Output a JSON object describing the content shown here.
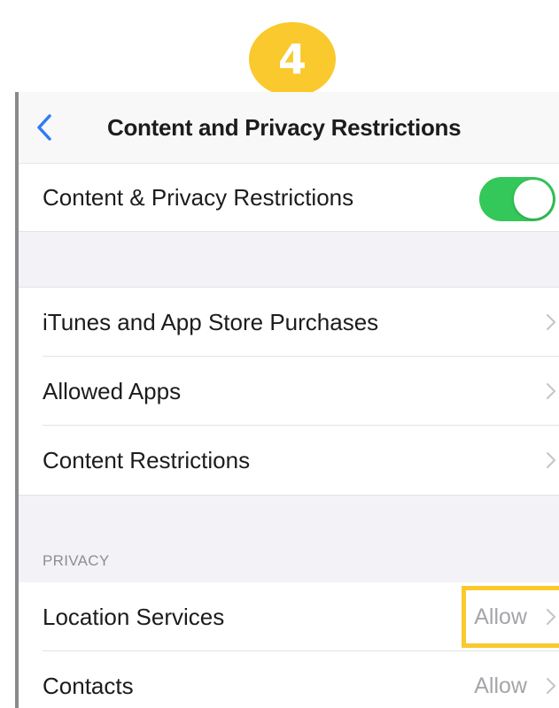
{
  "step_badge": "4",
  "navbar": {
    "title": "Content and Privacy Restrictions",
    "back_icon": "chevron-left-icon"
  },
  "master_toggle": {
    "label": "Content & Privacy Restrictions",
    "on": true,
    "color": "#34C759"
  },
  "restrictions": [
    {
      "label": "iTunes and App Store Purchases"
    },
    {
      "label": "Allowed Apps"
    },
    {
      "label": "Content Restrictions"
    }
  ],
  "privacy": {
    "header": "PRIVACY",
    "items": [
      {
        "label": "Location Services",
        "value": "Allow",
        "highlighted": true
      },
      {
        "label": "Contacts",
        "value": "Allow"
      }
    ]
  },
  "colors": {
    "accent_blue": "#2F7BF5",
    "highlight_yellow": "#F9C92D",
    "group_background": "#F2F2F7"
  }
}
